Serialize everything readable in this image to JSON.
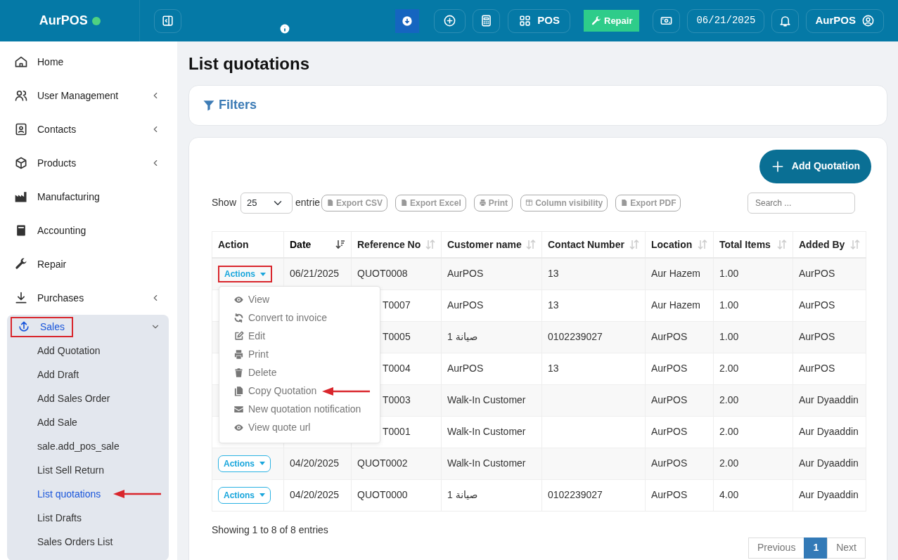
{
  "brand": {
    "name": "AurPOS",
    "online": true
  },
  "topbar": {
    "pos_label": "POS",
    "repair_label": "Repair",
    "date": "06/21/2025",
    "user": "AurPOS"
  },
  "sidebar": {
    "items": [
      {
        "label": "Home",
        "has_submenu": false,
        "expanded": false
      },
      {
        "label": "User Management",
        "has_submenu": true,
        "expanded": false
      },
      {
        "label": "Contacts",
        "has_submenu": true,
        "expanded": false
      },
      {
        "label": "Products",
        "has_submenu": true,
        "expanded": false
      },
      {
        "label": "Manufacturing",
        "has_submenu": false,
        "expanded": false
      },
      {
        "label": "Accounting",
        "has_submenu": false,
        "expanded": false
      },
      {
        "label": "Repair",
        "has_submenu": false,
        "expanded": false
      },
      {
        "label": "Purchases",
        "has_submenu": true,
        "expanded": false
      },
      {
        "label": "Sales",
        "has_submenu": true,
        "expanded": true,
        "highlighted": true,
        "children": [
          {
            "label": "Add Quotation",
            "selected": false,
            "arrow": false
          },
          {
            "label": "Add Draft",
            "selected": false,
            "arrow": false
          },
          {
            "label": "Add Sales Order",
            "selected": false,
            "arrow": false
          },
          {
            "label": "Add Sale",
            "selected": false,
            "arrow": false
          },
          {
            "label": "sale.add_pos_sale",
            "selected": false,
            "arrow": false
          },
          {
            "label": "List Sell Return",
            "selected": false,
            "arrow": false
          },
          {
            "label": "List quotations",
            "selected": true,
            "arrow": true
          },
          {
            "label": "List Drafts",
            "selected": false,
            "arrow": false
          },
          {
            "label": "Sales Orders List",
            "selected": false,
            "arrow": false
          }
        ]
      }
    ]
  },
  "page": {
    "title": "List quotations",
    "filters": "Filters",
    "add_button": "Add Quotation"
  },
  "table_controls": {
    "show_label": "Show",
    "page_length": "25",
    "entries_label": "entrie",
    "export_buttons": [
      "Export CSV",
      "Export Excel",
      "Print",
      "Column visibility",
      "Export PDF"
    ],
    "search": {
      "placeholder": "Search ..."
    }
  },
  "table": {
    "columns": [
      {
        "label": "Action",
        "sortable": false,
        "sorted": false
      },
      {
        "label": "Date",
        "sortable": true,
        "sorted": true
      },
      {
        "label": "Reference No",
        "sortable": true,
        "sorted": false
      },
      {
        "label": "Customer name",
        "sortable": true,
        "sorted": false
      },
      {
        "label": "Contact Number",
        "sortable": true,
        "sorted": false
      },
      {
        "label": "Location",
        "sortable": true,
        "sorted": false
      },
      {
        "label": "Total Items",
        "sortable": true,
        "sorted": false
      },
      {
        "label": "Added By",
        "sortable": true,
        "sorted": false
      }
    ],
    "rows": [
      {
        "action": "Actions",
        "highlighted": true,
        "date": "06/21/2025",
        "reference": "QUOT0008",
        "customer": "AurPOS",
        "contact": "13",
        "location": "Aur Hazem",
        "total_items": "1.00",
        "added_by": "AurPOS"
      },
      {
        "reference": "T0007",
        "customer": "AurPOS",
        "contact": "13",
        "location": "Aur Hazem",
        "total_items": "1.00",
        "added_by": "AurPOS"
      },
      {
        "reference": "T0005",
        "customer": "صيانة 1",
        "contact": "0102239027",
        "location": "AurPOS",
        "total_items": "1.00",
        "added_by": "AurPOS"
      },
      {
        "reference": "T0004",
        "customer": "AurPOS",
        "contact": "13",
        "location": "AurPOS",
        "total_items": "2.00",
        "added_by": "AurPOS"
      },
      {
        "reference": "T0003",
        "customer": "Walk-In Customer",
        "location": "AurPOS",
        "total_items": "2.00",
        "added_by": "Aur Dyaaddin"
      },
      {
        "reference": "T0001",
        "customer": "Walk-In Customer",
        "location": "AurPOS",
        "total_items": "2.00",
        "added_by": "Aur Dyaaddin"
      },
      {
        "action": "Actions",
        "highlighted": false,
        "date": "04/20/2025",
        "reference": "QUOT0002",
        "customer": "Walk-In Customer",
        "location": "AurPOS",
        "total_items": "2.00",
        "added_by": "Aur Dyaaddin"
      },
      {
        "action": "Actions",
        "highlighted": false,
        "date": "04/20/2025",
        "reference": "QUOT0000",
        "customer": "صيانة 1",
        "contact": "0102239027",
        "location": "AurPOS",
        "total_items": "4.00",
        "added_by": "Aur Dyaaddin"
      }
    ],
    "dropdown": {
      "items": [
        {
          "label": "View",
          "arrow": false
        },
        {
          "label": "Convert to invoice",
          "arrow": false
        },
        {
          "label": "Edit",
          "arrow": false
        },
        {
          "label": "Print",
          "arrow": false
        },
        {
          "label": "Delete",
          "arrow": false
        },
        {
          "label": "Copy Quotation",
          "arrow": true
        },
        {
          "label": "New quotation notification",
          "arrow": false
        },
        {
          "label": "View quote url",
          "arrow": false
        }
      ]
    }
  },
  "footer": {
    "info": "Showing 1 to 8 of 8 entries",
    "pagination": [
      {
        "label": "Previous",
        "selected": false
      },
      {
        "label": "1",
        "selected": true
      },
      {
        "label": "Next",
        "selected": false
      }
    ]
  }
}
